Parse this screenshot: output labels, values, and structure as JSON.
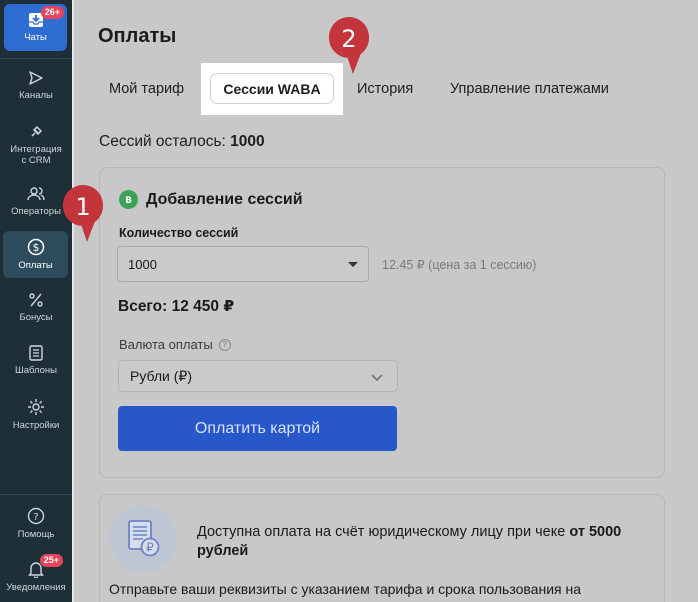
{
  "sidebar": {
    "chats": {
      "label": "Чаты",
      "badge": "26+"
    },
    "items": [
      {
        "label": "Каналы"
      },
      {
        "label_line1": "Интеграция",
        "label_line2": "с CRM"
      },
      {
        "label": "Операторы"
      },
      {
        "label": "Оплаты"
      },
      {
        "label": "Бонусы"
      },
      {
        "label": "Шаблоны"
      },
      {
        "label": "Настройки"
      }
    ],
    "bottom": [
      {
        "label": "Помощь"
      },
      {
        "label": "Уведомления",
        "badge": "25+"
      }
    ]
  },
  "page": {
    "title": "Оплаты"
  },
  "tabs": [
    {
      "label": "Мой тариф"
    },
    {
      "label": "Сессии WABA",
      "active": true
    },
    {
      "label": "История"
    },
    {
      "label": "Управление платежами"
    }
  ],
  "sessions": {
    "label": "Сессий осталось:",
    "value": "1000"
  },
  "add_sessions": {
    "title": "Добавление сессий",
    "quantity_label": "Количество сессий",
    "quantity_value": "1000",
    "price_hint": "12.45 ₽ (цена за 1 сессию)",
    "total": "Всего: 12 450 ₽",
    "currency_label": "Валюта оплаты",
    "currency_value": "Рубли (₽)",
    "pay_button": "Оплатить картой"
  },
  "invoice": {
    "text_main": "Доступна оплата на счёт юридическому лицу при чеке",
    "text_bold_1": "от",
    "text_bold_2": "5000 рублей",
    "footer": "Отправьте ваши реквизиты с указанием тарифа и срока пользования на"
  },
  "markers": [
    {
      "number": "1"
    },
    {
      "number": "2"
    }
  ],
  "colors": {
    "sidebar_bg": "#1e2f38",
    "accent": "#2f6cd1",
    "pay_button": "#2757c9",
    "badge": "#e5455a",
    "marker": "#c4343b"
  }
}
